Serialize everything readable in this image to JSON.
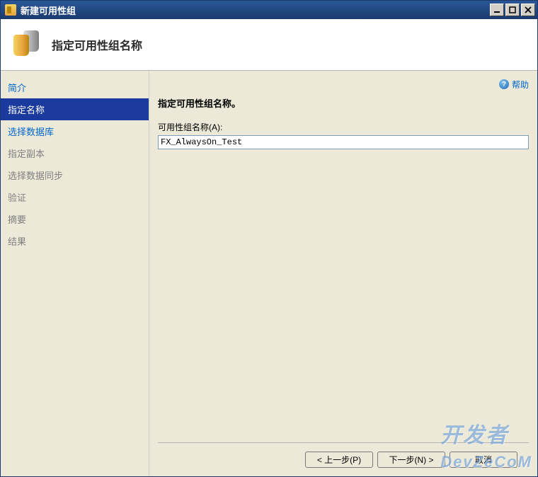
{
  "window": {
    "title": "新建可用性组"
  },
  "header": {
    "title": "指定可用性组名称"
  },
  "sidebar": {
    "items": [
      {
        "label": "简介",
        "state": "link"
      },
      {
        "label": "指定名称",
        "state": "selected"
      },
      {
        "label": "选择数据库",
        "state": "link"
      },
      {
        "label": "指定副本",
        "state": "muted"
      },
      {
        "label": "选择数据同步",
        "state": "muted"
      },
      {
        "label": "验证",
        "state": "muted"
      },
      {
        "label": "摘要",
        "state": "muted"
      },
      {
        "label": "结果",
        "state": "muted"
      }
    ]
  },
  "content": {
    "help_label": "帮助",
    "prompt": "指定可用性组名称。",
    "field_label": "可用性组名称(A):",
    "field_value": "FX_AlwaysOn_Test"
  },
  "footer": {
    "prev": "< 上一步(P)",
    "next": "下一步(N) >",
    "cancel": "取消"
  },
  "watermark": "开发者\nDevZeCoM"
}
